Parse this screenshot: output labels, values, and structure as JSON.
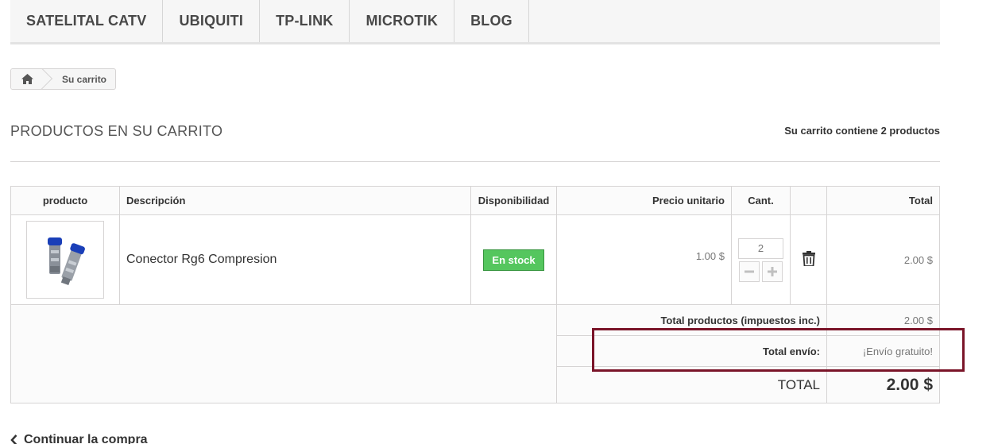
{
  "nav": {
    "items": [
      "SATELITAL CATV",
      "UBIQUITI",
      "TP-LINK",
      "MICROTIK",
      "BLOG"
    ]
  },
  "breadcrumb": {
    "home_icon": "home-icon",
    "current": "Su carrito"
  },
  "heading": {
    "title": "PRODUCTOS EN SU CARRITO",
    "summary": "Su carrito contiene 2 productos"
  },
  "table": {
    "headers": {
      "product": "producto",
      "description": "Descripción",
      "availability": "Disponibilidad",
      "unit_price": "Precio unitario",
      "quantity": "Cant.",
      "total": "Total"
    },
    "rows": [
      {
        "image_icon": "product-image-connector",
        "description": "Conector Rg6 Compresion",
        "availability": "En stock",
        "unit_price": "1.00 $",
        "quantity": "2",
        "total": "2.00 $"
      }
    ]
  },
  "totals": {
    "products_label": "Total productos (impuestos inc.)",
    "products_value": "2.00 $",
    "shipping_label": "Total envío:",
    "shipping_value": "¡Envío gratuito!",
    "grand_label": "TOTAL",
    "grand_value": "2.00 $"
  },
  "footer": {
    "continue_label": "Continuar la compra"
  },
  "colors": {
    "stock_badge": "#55c65e",
    "highlight_box": "#7a1428"
  }
}
